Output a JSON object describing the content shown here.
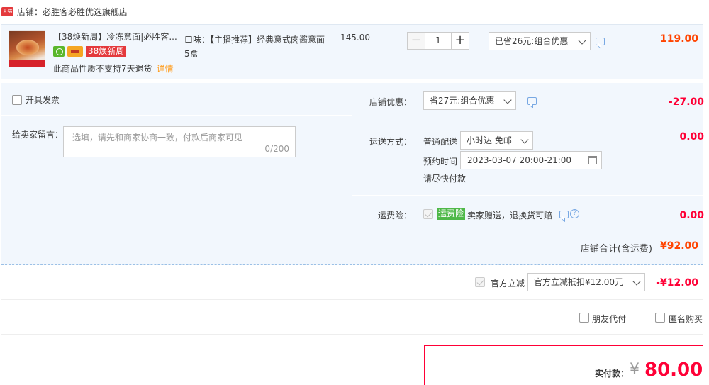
{
  "shop": {
    "badge": "天猫",
    "name": "店铺：必胜客必胜优选旗舰店"
  },
  "item": {
    "title": "【38焕新周】冷冻意面|必胜客...",
    "promo_tag": "38焕新周",
    "return_note": "此商品性质不支持7天退货",
    "detail_link": "详情",
    "flavor": "口味：【主播推荐】经典意式肉酱意面5盒",
    "unit_price": "145.00",
    "quantity": "1",
    "qty_minus": "−",
    "qty_plus": "+",
    "discount_select": "已省26元:组合优惠",
    "total": "119.00"
  },
  "options": {
    "invoice_label": "开具发票",
    "note_label": "给卖家留言：",
    "note_placeholder": "选填，请先和商家协商一致，付款后商家可见",
    "note_count": "0/200",
    "shop_discount_label": "店铺优惠：",
    "shop_discount_select": "省27元:组合优惠",
    "shop_discount_amount": "-27.00",
    "shipping_label": "运送方式：",
    "shipping_type": "普通配送",
    "shipping_select": "小时达 免邮",
    "schedule_label": "预约时间",
    "schedule_value": "2023-03-07 20:00-21:00",
    "schedule_note": "请尽快付款",
    "shipping_amount": "0.00",
    "insurance_label": "运费险：",
    "insurance_tag": "运费险",
    "insurance_text": "卖家赠送，退换货可赔",
    "insurance_help": "?",
    "insurance_amount": "0.00"
  },
  "subtotal": {
    "label": "店铺合计(含运费)",
    "value": "¥92.00"
  },
  "official": {
    "label": "官方立减",
    "select": "官方立减抵扣¥12.00元",
    "amount": "-¥12.00"
  },
  "extras": {
    "friend_pay": "朋友代付",
    "anonymous": "匿名购买"
  },
  "payment": {
    "label": "实付款：",
    "currency": "¥",
    "value": "80.00"
  },
  "colors": {
    "accent_red": "#ff0036",
    "accent_orange": "#ff4400",
    "panel_bg": "#f2f7fd",
    "link_blue": "#78a8e3",
    "insurance_green": "#4fb848"
  }
}
